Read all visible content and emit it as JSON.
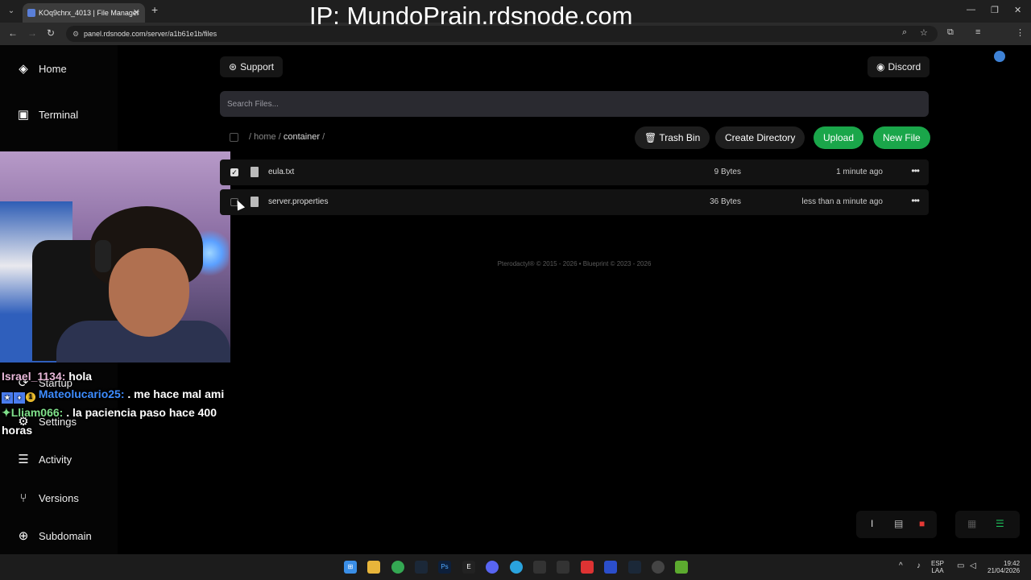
{
  "browser": {
    "tab_title": "KOq9chrx_4013 | File Manager",
    "url": "panel.rdsnode.com/server/a1b61e1b/files"
  },
  "overlay": {
    "ip_text": "IP: MundoPrain.rdsnode.com"
  },
  "sidebar": {
    "items": [
      {
        "label": "Home",
        "icon": "layers-icon"
      },
      {
        "label": "Terminal",
        "icon": "terminal-icon"
      },
      {
        "label": "Startup",
        "icon": "startup-icon"
      },
      {
        "label": "Settings",
        "icon": "gear-icon"
      },
      {
        "label": "Activity",
        "icon": "scroll-icon"
      },
      {
        "label": "Versions",
        "icon": "versions-icon"
      },
      {
        "label": "Subdomain",
        "icon": "globe-icon"
      }
    ]
  },
  "chat": {
    "messages": [
      {
        "user": "Israel_1134",
        "text": " hola"
      },
      {
        "user": "Mateolucario25:",
        "text": " . me hace mal ami"
      },
      {
        "user": "Lliam066:",
        "text": " . la paciencia paso hace 400 horas"
      }
    ]
  },
  "header": {
    "support_label": "Support",
    "discord_label": "Discord"
  },
  "search": {
    "placeholder": "Search Files..."
  },
  "breadcrumb": {
    "home": "home",
    "container": "container"
  },
  "actions": {
    "trash_label": "Trash Bin",
    "create_dir_label": "Create Directory",
    "upload_label": "Upload",
    "new_file_label": "New File"
  },
  "files": [
    {
      "name": "eula.txt",
      "size": "9 Bytes",
      "modified": "1 minute ago",
      "checked": true
    },
    {
      "name": "server.properties",
      "size": "36 Bytes",
      "modified": "less than a minute ago",
      "checked": false
    }
  ],
  "footer": {
    "text": "Pterodactyl® © 2015 - 2026  •  Blueprint © 2023 - 2026"
  },
  "colors": {
    "accent_green": "#1aa64a",
    "danger_red": "#e53935"
  },
  "taskbar": {
    "lang_top": "ESP",
    "lang_bottom": "LAA",
    "time": "19:42",
    "date": "21/04/2026"
  }
}
